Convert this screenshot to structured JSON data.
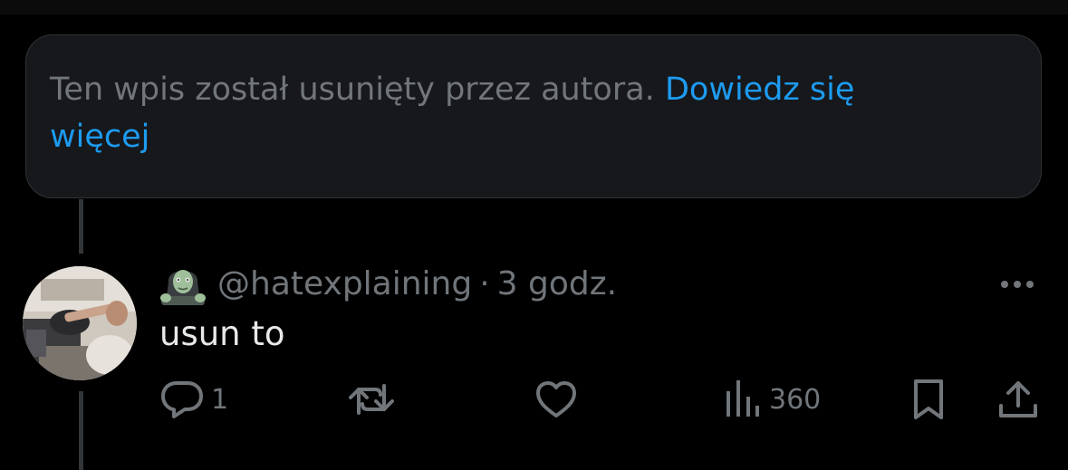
{
  "notice": {
    "text": "Ten wpis został usunięty przez autora.",
    "link_label": "Dowiedz się więcej"
  },
  "reply": {
    "handle": "@hatexplaining",
    "separator": "·",
    "time": "3 godz.",
    "text": "usun to",
    "user_emoji": "zombie-woman-icon",
    "actions": {
      "replies": "1",
      "views": "360"
    }
  },
  "colors": {
    "background": "#000000",
    "card": "#16181c",
    "muted_text": "#71767b",
    "primary_text": "#e7e9ea",
    "link": "#1d9bf0"
  }
}
